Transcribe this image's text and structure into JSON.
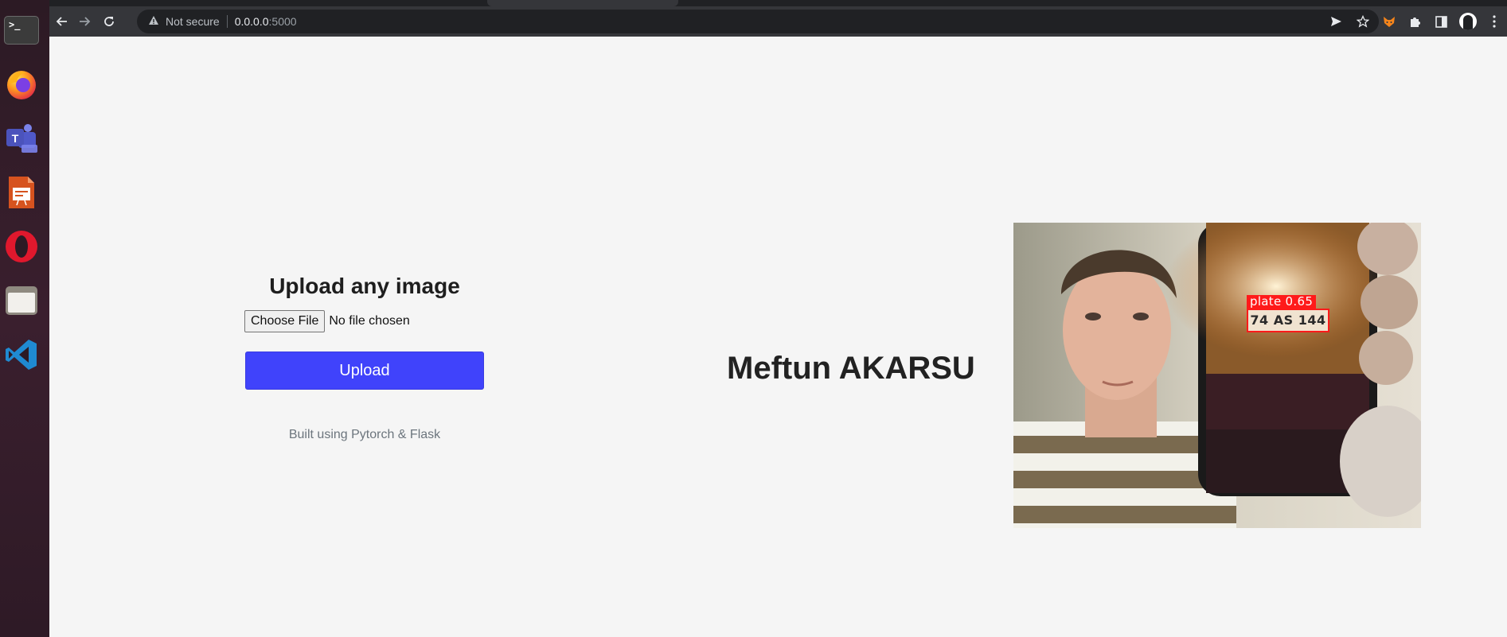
{
  "dock": {
    "items": [
      {
        "name": "terminal",
        "glyph": ">_"
      },
      {
        "name": "firefox"
      },
      {
        "name": "teams"
      },
      {
        "name": "libreoffice-impress"
      },
      {
        "name": "opera"
      },
      {
        "name": "files"
      },
      {
        "name": "vscode"
      }
    ]
  },
  "browser": {
    "security_label": "Not secure",
    "url_host": "0.0.0.0",
    "url_port": ":5000",
    "icons": [
      "back-icon",
      "forward-icon",
      "reload-icon",
      "warning-icon",
      "send-icon",
      "star-icon",
      "fox-extension-icon",
      "puzzle-icon",
      "side-panel-icon",
      "profile-avatar",
      "kebab-menu-icon"
    ]
  },
  "page": {
    "upload_title": "Upload any image",
    "choose_file_label": "Choose File",
    "no_file_text": "No file chosen",
    "upload_button_label": "Upload",
    "built_using": "Built using Pytorch & Flask",
    "author_name": "Meftun AKARSU"
  },
  "result_image": {
    "detection_label": "plate 0.65",
    "plate_text": "74 AS 144",
    "box_color": "#ff1a1a"
  },
  "colors": {
    "accent": "#4043fb",
    "page_bg": "#f5f5f5",
    "toolbar_bg": "#35363a"
  }
}
